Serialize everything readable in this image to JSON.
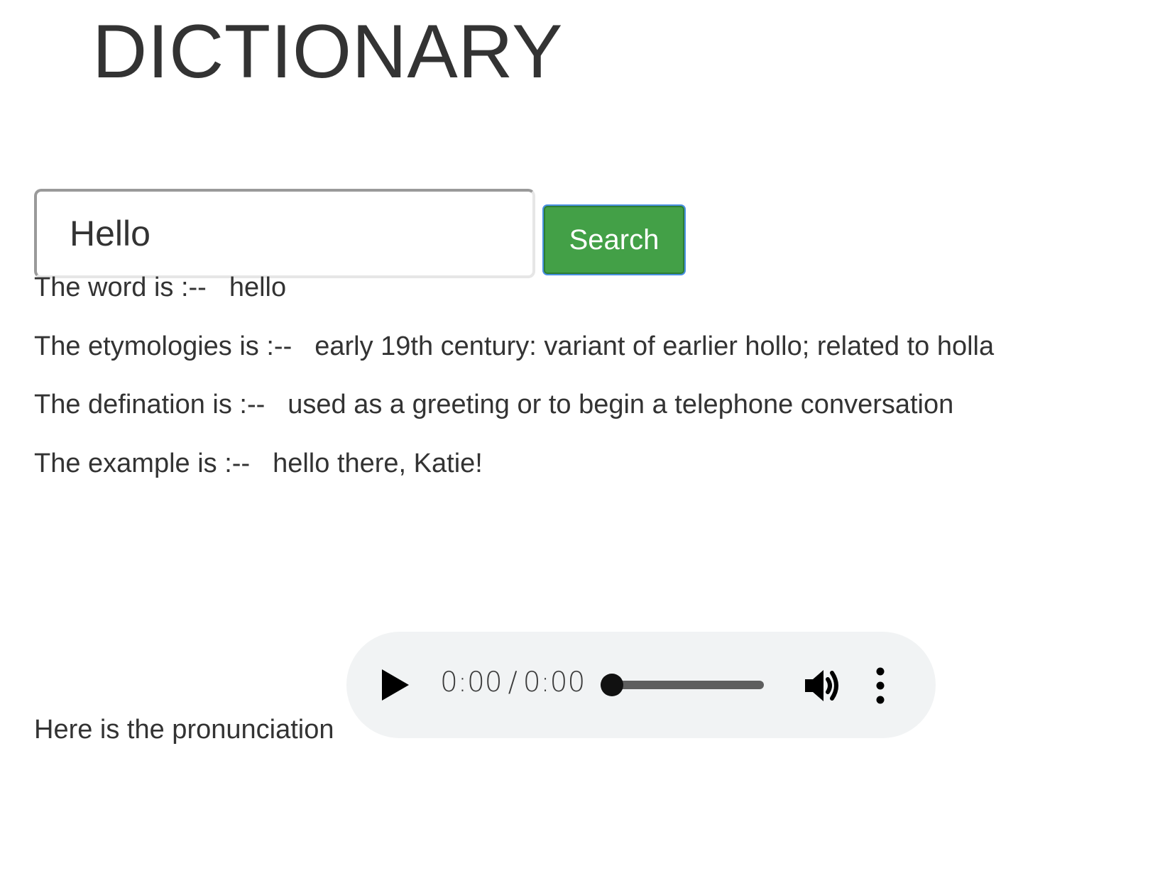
{
  "header": {
    "title": "DICTIONARY"
  },
  "search": {
    "input_value": "Hello",
    "button_label": "Search"
  },
  "results": {
    "word": {
      "label": "The word is :--",
      "value": "hello"
    },
    "etymology": {
      "label": "The etymologies is :--",
      "value": "early 19th century: variant of earlier hollo; related to holla"
    },
    "definition": {
      "label": "The defination is :--",
      "value": "used as a greeting or to begin a telephone conversation"
    },
    "example": {
      "label": "The example is :--",
      "value": "hello there, Katie!"
    }
  },
  "pronunciation": {
    "label": "Here is the pronunciation",
    "player": {
      "current_time": "0:00",
      "separator": "/",
      "duration": "0:00",
      "progress": 0,
      "icons": [
        "play-icon",
        "volume-icon",
        "more-vertical-icon"
      ]
    }
  },
  "colors": {
    "button_green": "#43a047",
    "focus_ring": "#4a90e2",
    "player_bg": "#f1f3f4",
    "text": "#333333"
  }
}
